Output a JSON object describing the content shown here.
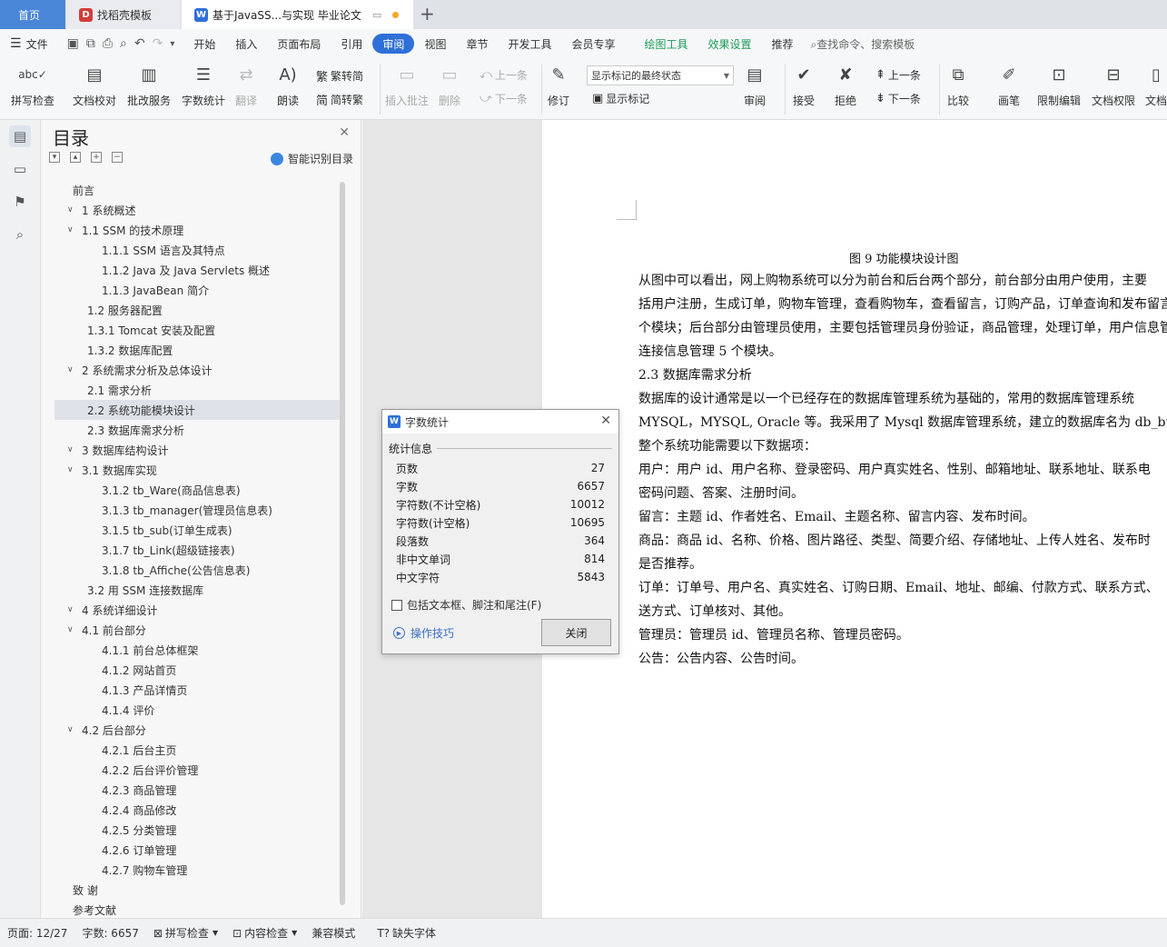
{
  "tabs": {
    "home": "首页",
    "template": "找稻壳模板",
    "doc": "基于JavaSS...与实现 毕业论文"
  },
  "menubar": {
    "file": "文件",
    "items": [
      "开始",
      "插入",
      "页面布局",
      "引用",
      "审阅",
      "视图",
      "章节",
      "开发工具",
      "会员专享"
    ],
    "active": "审阅",
    "extra": [
      "绘图工具",
      "效果设置",
      "推荐"
    ],
    "search_placeholder": "查找命令、搜索模板"
  },
  "ribbon": {
    "spell": "拼写检查",
    "proof": "文档校对",
    "batch": "批改服务",
    "wordcount": "字数统计",
    "translate": "翻译",
    "read": "朗读",
    "trad": "繁转简",
    "simp": "简转繁",
    "insert_comment": "插入批注",
    "delete": "删除",
    "prev_comment": "上一条",
    "next_comment": "下一条",
    "track": "修订",
    "markup_state": "显示标记的最终状态",
    "show_markup": "显示标记",
    "review": "审阅",
    "accept": "接受",
    "reject": "拒绝",
    "prev": "上一条",
    "next": "下一条",
    "compare": "比较",
    "pen": "画笔",
    "restrict": "限制编辑",
    "permission": "文档权限",
    "more": "文档"
  },
  "toc": {
    "title": "目录",
    "smart": "智能识别目录",
    "items": [
      {
        "text": "前言",
        "level": 0
      },
      {
        "text": "1  系统概述",
        "level": 0
      },
      {
        "text": "1.1 SSM 的技术原理",
        "level": 1
      },
      {
        "text": "1.1.1 SSM 语言及其特点",
        "level": 2
      },
      {
        "text": "1.1.2 Java 及 Java Servlets 概述",
        "level": 2
      },
      {
        "text": "1.1.3 JavaBean 简介",
        "level": 2
      },
      {
        "text": "1.2  服务器配置",
        "level": 1
      },
      {
        "text": "1.3.1 Tomcat 安装及配置",
        "level": 1
      },
      {
        "text": "1.3.2  数据库配置",
        "level": 1
      },
      {
        "text": "2  系统需求分析及总体设计",
        "level": 0
      },
      {
        "text": "2.1  需求分析",
        "level": 1
      },
      {
        "text": "2.2  系统功能模块设计",
        "level": 1
      },
      {
        "text": "2.3  数据库需求分析",
        "level": 1
      },
      {
        "text": "3  数据库结构设计",
        "level": 0
      },
      {
        "text": "3.1  数据库实现",
        "level": 1
      },
      {
        "text": "3.1.2 tb_Ware(商品信息表)",
        "level": 2
      },
      {
        "text": "3.1.3 tb_manager(管理员信息表)",
        "level": 2
      },
      {
        "text": "3.1.5 tb_sub(订单生成表)",
        "level": 2
      },
      {
        "text": "3.1.7 tb_Link(超级链接表)",
        "level": 2
      },
      {
        "text": "3.1.8 tb_Affiche(公告信息表)",
        "level": 2
      },
      {
        "text": "3.2  用 SSM 连接数据库",
        "level": 1
      },
      {
        "text": "4  系统详细设计",
        "level": 0
      },
      {
        "text": "4.1  前台部分",
        "level": 1
      },
      {
        "text": "4.1.1  前台总体框架",
        "level": 2
      },
      {
        "text": "4.1.2  网站首页",
        "level": 2
      },
      {
        "text": "4.1.3  产品详情页",
        "level": 2
      },
      {
        "text": "4.1.4  评价",
        "level": 2
      },
      {
        "text": "4.2  后台部分",
        "level": 1
      },
      {
        "text": "4.2.1  后台主页",
        "level": 2
      },
      {
        "text": "4.2.2  后台评价管理",
        "level": 2
      },
      {
        "text": "4.2.3  商品管理",
        "level": 2
      },
      {
        "text": "4.2.4  商品修改",
        "level": 2
      },
      {
        "text": "4.2.5  分类管理",
        "level": 2
      },
      {
        "text": "4.2.6  订单管理",
        "level": 2
      },
      {
        "text": "4.2.7  购物车管理",
        "level": 2
      },
      {
        "text": "致    谢",
        "level": 0
      },
      {
        "text": "参考文献",
        "level": 0
      }
    ]
  },
  "document": {
    "lines": [
      "图 9    功能模块设计图",
      "    从图中可以看出，网上购物系统可以分为前台和后台两个部分，前台部分由用户使用，主要",
      "括用户注册，生成订单，购物车管理，查看购物车，查看留言，订购产品，订单查询和发布留言",
      "个模块；后台部分由管理员使用，主要包括管理员身份验证，商品管理，处理订单，用户信息管",
      "连接信息管理 5 个模块。",
      "    2.3 数据库需求分析",
      "    数据库的设计通常是以一个已经存在的数据库管理系统为基础的，常用的数据库管理系统",
      "MYSQL，MYSQL, Oracle 等。我采用了 Mysql 数据库管理系统，建立的数据库名为 db_business",
      "    整个系统功能需要以下数据项：",
      "    用户：用户 id、用户名称、登录密码、用户真实姓名、性别、邮箱地址、联系地址、联系电",
      "密码问题、答案、注册时间。",
      "   留言：主题 id、作者姓名、Email、主题名称、留言内容、发布时间。",
      "   商品：商品 id、名称、价格、图片路径、类型、简要介绍、存储地址、上传人姓名、发布时",
      "是否推荐。",
      "   订单：订单号、用户名、真实姓名、订购日期、Email、地址、邮编、付款方式、联系方式、",
      "送方式、订单核对、其他。",
      "  管理员：管理员 id、管理员名称、管理员密码。",
      "  公告：公告内容、公告时间。"
    ]
  },
  "dialog": {
    "title": "字数统计",
    "group": "统计信息",
    "stats": [
      {
        "label": "页数",
        "value": "27"
      },
      {
        "label": "字数",
        "value": "6657"
      },
      {
        "label": "字符数(不计空格)",
        "value": "10012"
      },
      {
        "label": "字符数(计空格)",
        "value": "10695"
      },
      {
        "label": "段落数",
        "value": "364"
      },
      {
        "label": "非中文单词",
        "value": "814"
      },
      {
        "label": "中文字符",
        "value": "5843"
      }
    ],
    "include": "包括文本框、脚注和尾注(F)",
    "tips": "操作技巧",
    "close": "关闭"
  },
  "status": {
    "page": "页面: 12/27",
    "words": "字数: 6657",
    "spell": "拼写检查",
    "content": "内容检查",
    "compat": "兼容模式",
    "missing_font": "缺失字体"
  }
}
